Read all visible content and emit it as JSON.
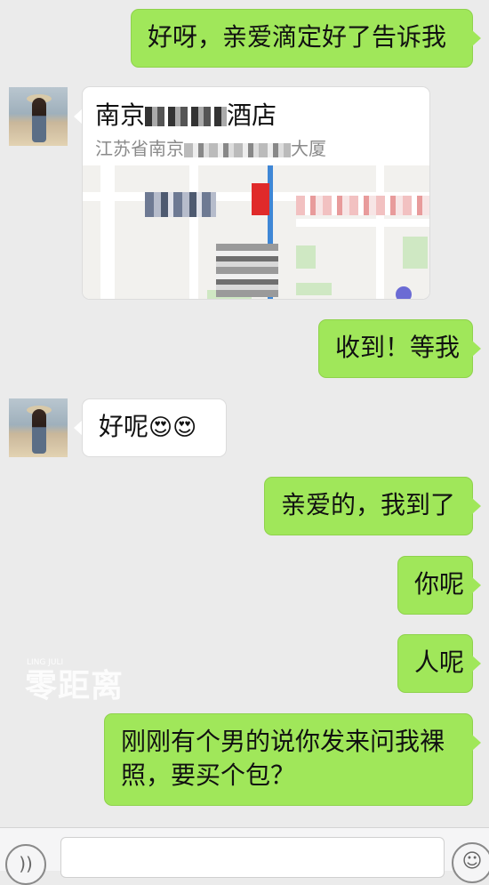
{
  "chat": {
    "msg1": "好呀，亲爱滴定好了告诉我",
    "location": {
      "title": "南京",
      "title_suffix": "酒店",
      "address": "江苏省南京",
      "address_suffix": "大厦"
    },
    "msg3": "收到！等我",
    "msg4_text": "好呢",
    "msg4_emoji": "😍😍",
    "msg5": "亲爱的，我到了",
    "msg6": "你呢",
    "msg7": "人呢",
    "msg8_line1": "刚刚有个男的说你发来问我裸",
    "msg8_line2": "照，要买个包？"
  },
  "watermark": {
    "text": "零距离",
    "sub": "LING JULI"
  },
  "colors": {
    "sent_bubble": "#a0e75a",
    "received_bubble": "#ffffff",
    "background": "#ebebeb"
  },
  "icons": {
    "voice": "voice-icon",
    "emoji": "emoji-icon"
  }
}
